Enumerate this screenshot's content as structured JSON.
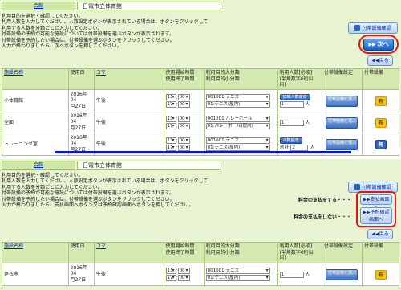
{
  "section1": {
    "hall_label": "会館",
    "hall_name": "日電市立体育館",
    "instructions": [
      "利用目的を選択・確認してください。",
      "利用人数を入力してください。人数設定ボタンが表示されている場合は、ボタンをクリックして",
      "利用する人数を分類ごとに入力してください。",
      "付帯設備の予約が可能な施設については付帯設備を選ぶボタンが表示されます。",
      "付帯設備を予約したい場合は、付帯設備を選ぶボタンをクリックしてください。",
      "入力が終わりましたら、次へボタンを押してください。"
    ],
    "confirm_button": "付帯設備確認",
    "next_button": "次へ",
    "back_button": "戻る",
    "columns": {
      "facility": "施設名称",
      "date": "使用日",
      "koma": "コマ",
      "time1": "使用開始時間",
      "time2": "使用終了時間",
      "purpose1": "利用目的大分類",
      "purpose2": "利用目的小分類",
      "people1": "利用人数[必須]",
      "people2": "(半角数字6桁以内)",
      "equip_setting": "付帯設備設定",
      "equip": "付帯設備"
    },
    "rows": [
      {
        "facility": "小体育館",
        "date1": "2016年04",
        "date2": "月27日",
        "koma": "午後",
        "start_h": "13",
        "start_m": "00",
        "end_h": "17",
        "end_m": "00",
        "purpose1": "001001:テニス",
        "purpose2": "01:テニス(屋内)",
        "people_btn": "詳細人数設定",
        "people_value": "1",
        "people_unit": "人",
        "equip_btn": "付帯設備を選ぶ",
        "equip_badge": "有"
      },
      {
        "facility": "全面",
        "date1": "2016年04",
        "date2": "月27日",
        "koma": "午後",
        "start_h": "13",
        "start_m": "00",
        "end_h": "17",
        "end_m": "00",
        "purpose1": "001201:バレーボール",
        "purpose2": "01:バレーボール(屋内)",
        "people_value": "1",
        "people_unit": "人",
        "equip_btn": "付帯設備を選ぶ",
        "equip_badge": "有"
      },
      {
        "facility": "トレーニング室",
        "date1": "2016年04",
        "date2": "月27日",
        "koma": "午後",
        "start_h": "13",
        "start_m": "00",
        "end_h": "17",
        "end_m": "00",
        "purpose1": "001001:テニス",
        "purpose2": "01:テニス(屋内)",
        "people_btn": "人数設定",
        "people_total_label": "合計",
        "people_value": "2",
        "people_unit": "人",
        "equip_btn": "付帯設備を選ぶ",
        "equip_badge": "無"
      }
    ]
  },
  "section2": {
    "hall_label": "会館",
    "hall_name": "日電市立体育館",
    "instructions": [
      "利用目的を選択・確認してください。",
      "利用人数を入力してください。人数設定ボタンが表示されている場合は、ボタンをクリックして",
      "利用する人数を分類ごとに入力してください。",
      "付帯設備の予約が可能な施設については付帯設備を選ぶボタンが表示されます。",
      "付帯設備を予約したい場合は、付帯設備を選ぶボタンをクリックしてください。",
      "入力が終わりましたら、支払画面へボタン又は予約確認画面へボタンを押してください。"
    ],
    "confirm_button": "付帯設備確認",
    "pay_note": "料金の支払をする・・・",
    "no_pay_note": "料金の支払をしない・・・",
    "pay_button": "支払画面へ",
    "confirm_screen_button1": "予約確認",
    "confirm_screen_button2": "画面へ",
    "back_button": "戻る",
    "rows": [
      {
        "facility": "更衣室",
        "date1": "2016年04",
        "date2": "月27日",
        "koma": "午後",
        "start_h": "13",
        "start_m": "00",
        "end_h": "17",
        "end_m": "00",
        "purpose1": "001001:テニス",
        "purpose2": "01:テニス(屋内)",
        "people_value": "1",
        "people_unit": "人",
        "equip_btn": "付帯設備を選ぶ",
        "equip_badge": "有"
      }
    ]
  },
  "colors": {
    "panel": "#e8f3d2",
    "header_cell": "#d4e9b0",
    "divider": "#0a12e0",
    "highlight": "#e8101b",
    "next": "#1a5fc6",
    "badge_yes": "#f2c418",
    "badge_no": "#2f62c2"
  },
  "icons": [
    "document-icon",
    "arrow-right-icon",
    "arrow-left-icon"
  ]
}
